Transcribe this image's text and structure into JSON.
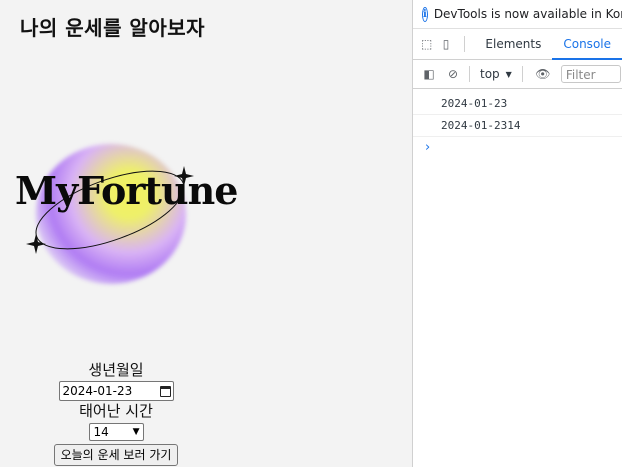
{
  "page": {
    "title": "나의 운세를 알아보자",
    "logo_text": "MyFortune",
    "birth_label": "생년월일",
    "birth_date_value": "2024-01-23",
    "time_label": "태어난 시간",
    "time_value": "14",
    "submit_label": "오늘의 운세 보러 가기"
  },
  "devtools": {
    "notice": "DevTools is now available in Korea",
    "tabs": [
      "Elements",
      "Console"
    ],
    "active_tab": "Console",
    "context": "top",
    "filter_placeholder": "Filter",
    "logs": [
      "2024-01-23",
      "2024-01-2314"
    ],
    "accent": "#1a73e8"
  }
}
